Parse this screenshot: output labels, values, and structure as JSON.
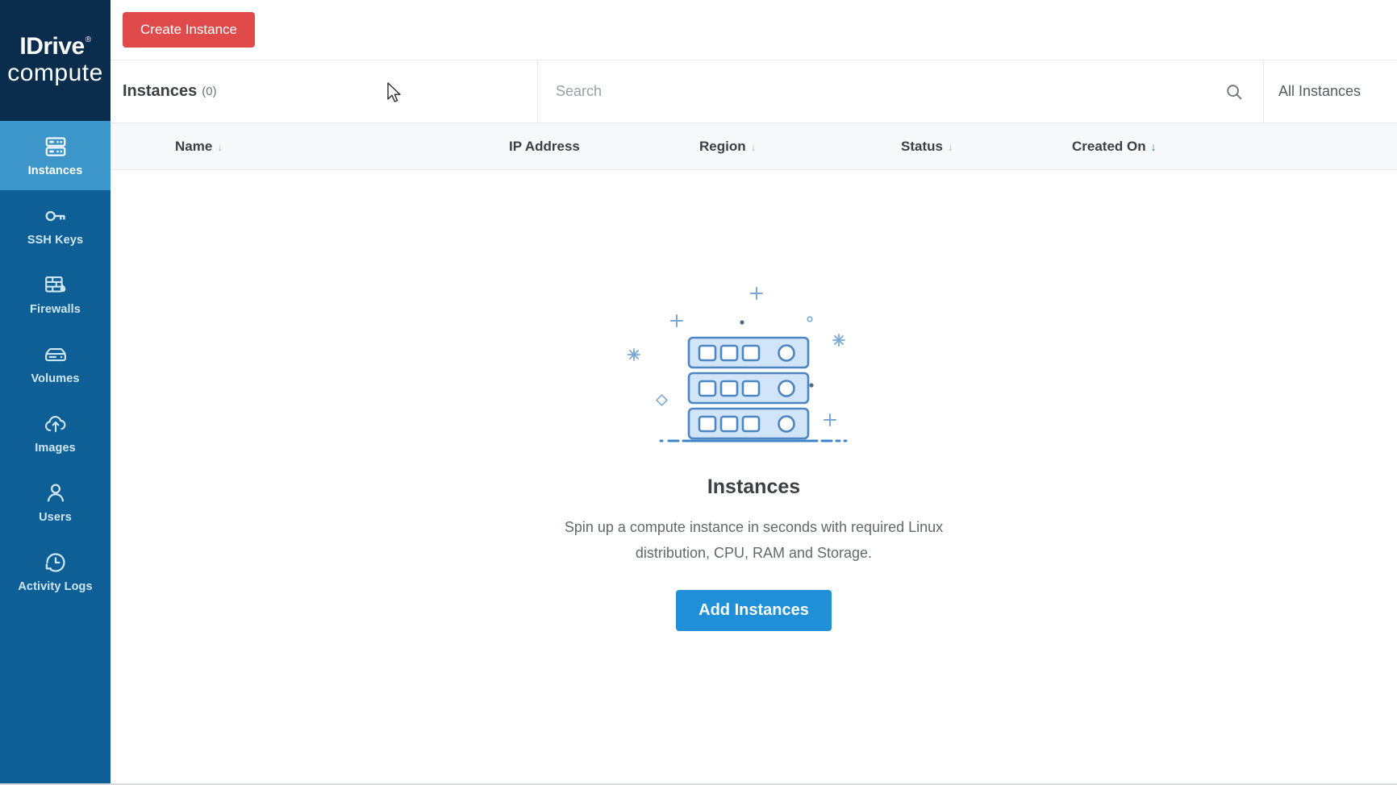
{
  "brand": {
    "line1": "IDrive",
    "registered": "®",
    "line2": "compute"
  },
  "colors": {
    "sidebar_bg": "#0d5f96",
    "sidebar_logo_bg": "#0a2d4d",
    "sidebar_active_bg": "#3d96c9",
    "create_button": "#e04a4a",
    "add_button": "#1f8fd8",
    "active_sort": "#1f7dc4",
    "illustration_stroke": "#5b9bd5",
    "illustration_fill": "#cfe3f7"
  },
  "sidebar": {
    "items": [
      {
        "id": "instances",
        "label": "Instances",
        "icon": "server-icon",
        "active": true
      },
      {
        "id": "ssh-keys",
        "label": "SSH Keys",
        "icon": "key-icon",
        "active": false
      },
      {
        "id": "firewalls",
        "label": "Firewalls",
        "icon": "firewall-icon",
        "active": false
      },
      {
        "id": "volumes",
        "label": "Volumes",
        "icon": "volume-disk-icon",
        "active": false
      },
      {
        "id": "images",
        "label": "Images",
        "icon": "cloud-upload-icon",
        "active": false
      },
      {
        "id": "users",
        "label": "Users",
        "icon": "user-icon",
        "active": false
      },
      {
        "id": "activity-logs",
        "label": "Activity Logs",
        "icon": "history-clock-icon",
        "active": false
      }
    ]
  },
  "toolbar": {
    "create_label": "Create Instance"
  },
  "subheader": {
    "title": "Instances",
    "count": "(0)",
    "search_placeholder": "Search",
    "search_value": "",
    "search_icon": "search-icon",
    "filter_selected": "All Instances"
  },
  "table": {
    "columns": [
      {
        "label": "Name",
        "sorted": false,
        "sortable": true
      },
      {
        "label": "IP Address",
        "sorted": false,
        "sortable": false
      },
      {
        "label": "Region",
        "sorted": false,
        "sortable": true
      },
      {
        "label": "Status",
        "sorted": false,
        "sortable": true
      },
      {
        "label": "Created On",
        "sorted": true,
        "sortable": true
      }
    ],
    "rows": []
  },
  "empty_state": {
    "illustration": "server-rack-illustration",
    "title": "Instances",
    "description": "Spin up a compute instance in seconds with required Linux distribution, CPU, RAM and Storage.",
    "button_label": "Add Instances"
  }
}
